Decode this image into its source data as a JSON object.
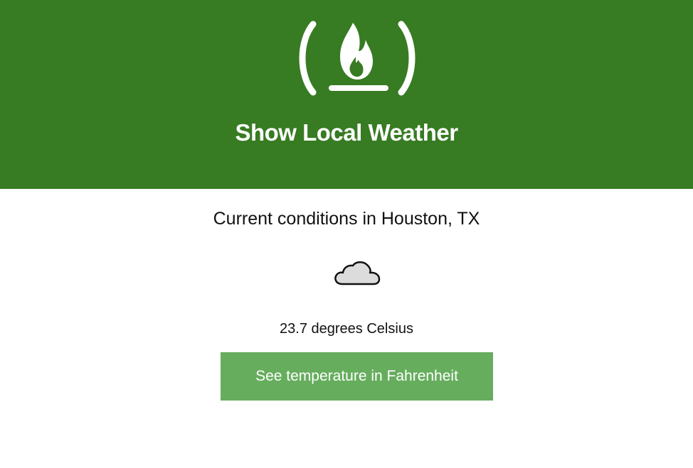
{
  "header": {
    "logo_icon": "freecodecamp-fire-logo-icon",
    "title": "Show Local Weather",
    "background_color": "#377b22"
  },
  "main": {
    "conditions_title": "Current conditions in Houston, TX",
    "weather_icon": "cloud-icon",
    "temperature": "23.7 degrees Celsius",
    "toggle_button_label": "See temperature in Fahrenheit",
    "button_color": "#66ad5e"
  }
}
